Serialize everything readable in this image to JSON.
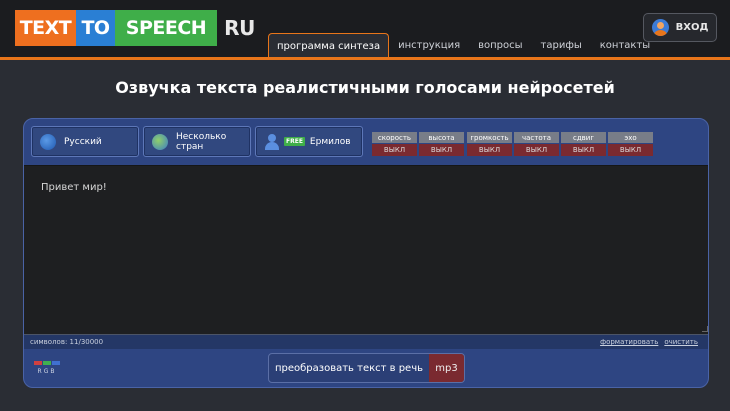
{
  "header": {
    "logo": {
      "part1": "TEXT",
      "part2": "TO",
      "part3": "SPEECH",
      "part4": "RU"
    },
    "nav": [
      "программа синтеза",
      "инструкция",
      "вопросы",
      "тарифы",
      "контакты"
    ],
    "login_label": "ВХОД"
  },
  "title": "Озвучка текста реалистичными голосами нейросетей",
  "selectors": {
    "language": "Русский",
    "country": "Несколько стран",
    "voice_badge": "FREE",
    "voice": "Ермилов"
  },
  "params": [
    {
      "name": "скорость",
      "value": "ВЫКЛ"
    },
    {
      "name": "высота",
      "value": "ВЫКЛ"
    },
    {
      "name": "громкость",
      "value": "ВЫКЛ"
    },
    {
      "name": "частота",
      "value": "ВЫКЛ"
    },
    {
      "name": "сдвиг",
      "value": "ВЫКЛ"
    },
    {
      "name": "эхо",
      "value": "ВЫКЛ"
    }
  ],
  "editor": {
    "text": "Привет мир!"
  },
  "status": {
    "count": "символов: 11/30000",
    "format": "форматировать",
    "clear": "очистить"
  },
  "rgb_label": "RGB",
  "convert": {
    "label": "преобразовать текст в речь",
    "format": "mp3"
  },
  "colors": {
    "accent": "#e8751a",
    "panel": "#2e4582",
    "off": "#7a2a30"
  }
}
